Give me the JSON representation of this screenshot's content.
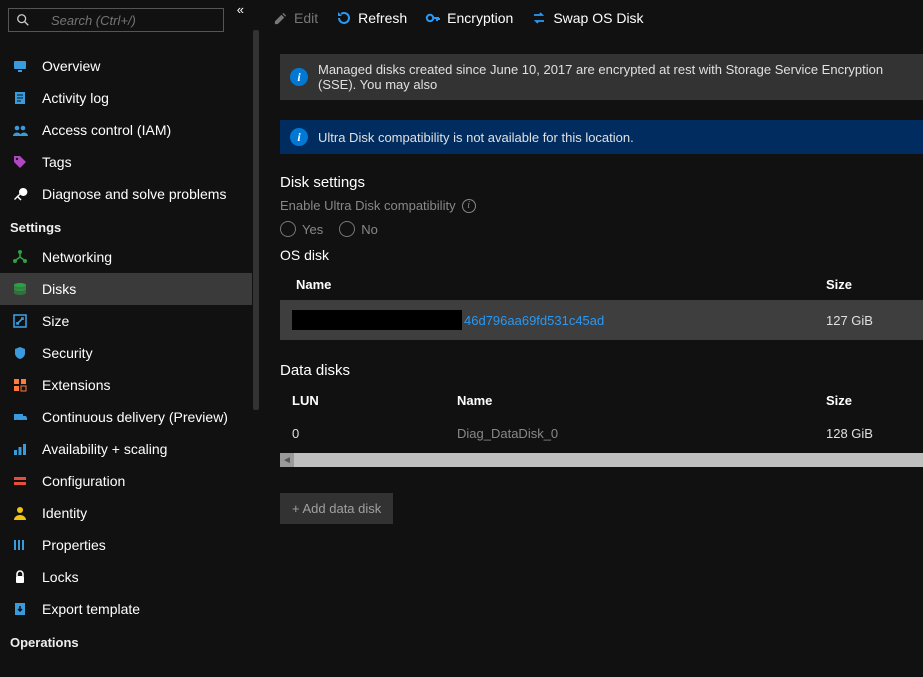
{
  "search": {
    "placeholder": "Search (Ctrl+/)"
  },
  "sidebar": {
    "top": [
      {
        "label": "Overview",
        "icon": "monitor",
        "iconColor": "#3a9bdc"
      },
      {
        "label": "Activity log",
        "icon": "log",
        "iconColor": "#3a9bdc"
      },
      {
        "label": "Access control (IAM)",
        "icon": "people",
        "iconColor": "#3a9bdc"
      },
      {
        "label": "Tags",
        "icon": "tag",
        "iconColor": "#b146c2"
      },
      {
        "label": "Diagnose and solve problems",
        "icon": "wrench",
        "iconColor": "#ffffff"
      }
    ],
    "settings_label": "Settings",
    "settings": [
      {
        "label": "Networking",
        "icon": "network",
        "iconColor": "#2ea043"
      },
      {
        "label": "Disks",
        "icon": "disks",
        "iconColor": "#2ea043",
        "active": true
      },
      {
        "label": "Size",
        "icon": "size",
        "iconColor": "#3a9bdc"
      },
      {
        "label": "Security",
        "icon": "shield",
        "iconColor": "#3a9bdc"
      },
      {
        "label": "Extensions",
        "icon": "extensions",
        "iconColor": "#ff7b3d"
      },
      {
        "label": "Continuous delivery (Preview)",
        "icon": "delivery",
        "iconColor": "#3a9bdc"
      },
      {
        "label": "Availability + scaling",
        "icon": "scaling",
        "iconColor": "#3a9bdc"
      },
      {
        "label": "Configuration",
        "icon": "config",
        "iconColor": "#e74c3c"
      },
      {
        "label": "Identity",
        "icon": "identity",
        "iconColor": "#f1c40f"
      },
      {
        "label": "Properties",
        "icon": "properties",
        "iconColor": "#3a9bdc"
      },
      {
        "label": "Locks",
        "icon": "lock",
        "iconColor": "#ffffff"
      },
      {
        "label": "Export template",
        "icon": "export",
        "iconColor": "#3a9bdc"
      }
    ],
    "operations_label": "Operations"
  },
  "toolbar": {
    "edit": "Edit",
    "refresh": "Refresh",
    "encryption": "Encryption",
    "swap": "Swap OS Disk"
  },
  "banners": {
    "sse": "Managed disks created since June 10, 2017 are encrypted at rest with Storage Service Encryption (SSE). You may also",
    "ultra": "Ultra Disk compatibility is not available for this location."
  },
  "sections": {
    "disk_settings": "Disk settings",
    "ultra_label": "Enable Ultra Disk compatibility",
    "yes": "Yes",
    "no": "No",
    "os_disk": "OS disk",
    "data_disks": "Data disks"
  },
  "os_table": {
    "headers": {
      "name": "Name",
      "size": "Size"
    },
    "row": {
      "name_suffix": "46d796aa69fd531c45ad",
      "size": "127 GiB"
    }
  },
  "data_table": {
    "headers": {
      "lun": "LUN",
      "name": "Name",
      "size": "Size"
    },
    "row": {
      "lun": "0",
      "name": "Diag_DataDisk_0",
      "size": "128 GiB"
    }
  },
  "add_disk": "+ Add data disk"
}
